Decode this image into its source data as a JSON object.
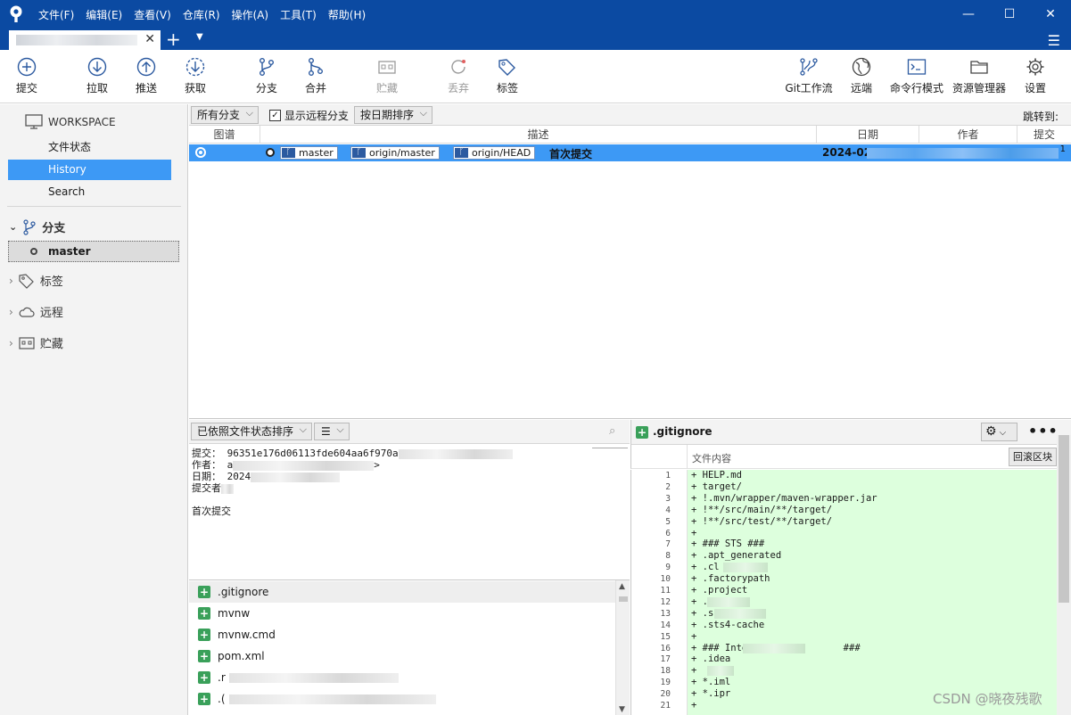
{
  "menu": [
    "文件(F)",
    "编辑(E)",
    "查看(V)",
    "仓库(R)",
    "操作(A)",
    "工具(T)",
    "帮助(H)"
  ],
  "toolbar": {
    "commit": "提交",
    "pull": "拉取",
    "push": "推送",
    "fetch": "获取",
    "branch": "分支",
    "merge": "合并",
    "stash": "贮藏",
    "discard": "丢弃",
    "tag": "标签",
    "gitflow": "Git工作流",
    "remote": "远端",
    "terminal": "命令行模式",
    "explorer": "资源管理器",
    "settings": "设置"
  },
  "sidebar": {
    "workspace": "WORKSPACE",
    "file_status": "文件状态",
    "history": "History",
    "search": "Search",
    "branches": "分支",
    "current_branch": "master",
    "tags": "标签",
    "remotes": "远程",
    "stashes": "贮藏"
  },
  "history_bar": {
    "branch_filter": "所有分支",
    "show_remote": "显示远程分支",
    "sort": "按日期排序",
    "jump_to": "跳转到:"
  },
  "columns": {
    "graph": "图谱",
    "description": "描述",
    "date": "日期",
    "author": "作者",
    "commit": "提交"
  },
  "commit_row": {
    "refs": [
      "master",
      "origin/master",
      "origin/HEAD"
    ],
    "message": "首次提交",
    "date": "2024-02-",
    "commit_tail": "1"
  },
  "details": {
    "sort_label": "已依照文件状态排序",
    "list_view": "☰",
    "commit_line": "提交： 96351e176d06113fde604aa6f970a",
    "author_line": "作者： a",
    "author_tail": ">",
    "date_line": "日期： 2024",
    "committer_line": "提交者",
    "message": "首次提交"
  },
  "files": [
    ".gitignore",
    "mvnw",
    "mvnw.cmd",
    "pom.xml",
    ".r",
    ".("
  ],
  "diff": {
    "file": ".gitignore",
    "content_label": "文件内容",
    "revert_label": "回滚区块",
    "lines": [
      "+ HELP.md",
      "+ target/",
      "+ !.mvn/wrapper/maven-wrapper.jar",
      "+ !**/src/main/**/target/",
      "+ !**/src/test/**/target/",
      "+",
      "+ ### STS ###",
      "+ .apt_generated",
      "+ .cl",
      "+ .factorypath",
      "+ .project",
      "+ .",
      "+ .s",
      "+ .sts4-cache",
      "+",
      "+ ### Inte                 ###",
      "+ .idea",
      "+",
      "+ *.iml",
      "+ *.ipr",
      "+"
    ]
  },
  "watermark": "CSDN @晓夜残歌",
  "colors": {
    "titlebar": "#0b4aa2",
    "selection": "#3d99f5",
    "diff_add": "#ddffdd",
    "add_icon": "#3aa05a"
  }
}
